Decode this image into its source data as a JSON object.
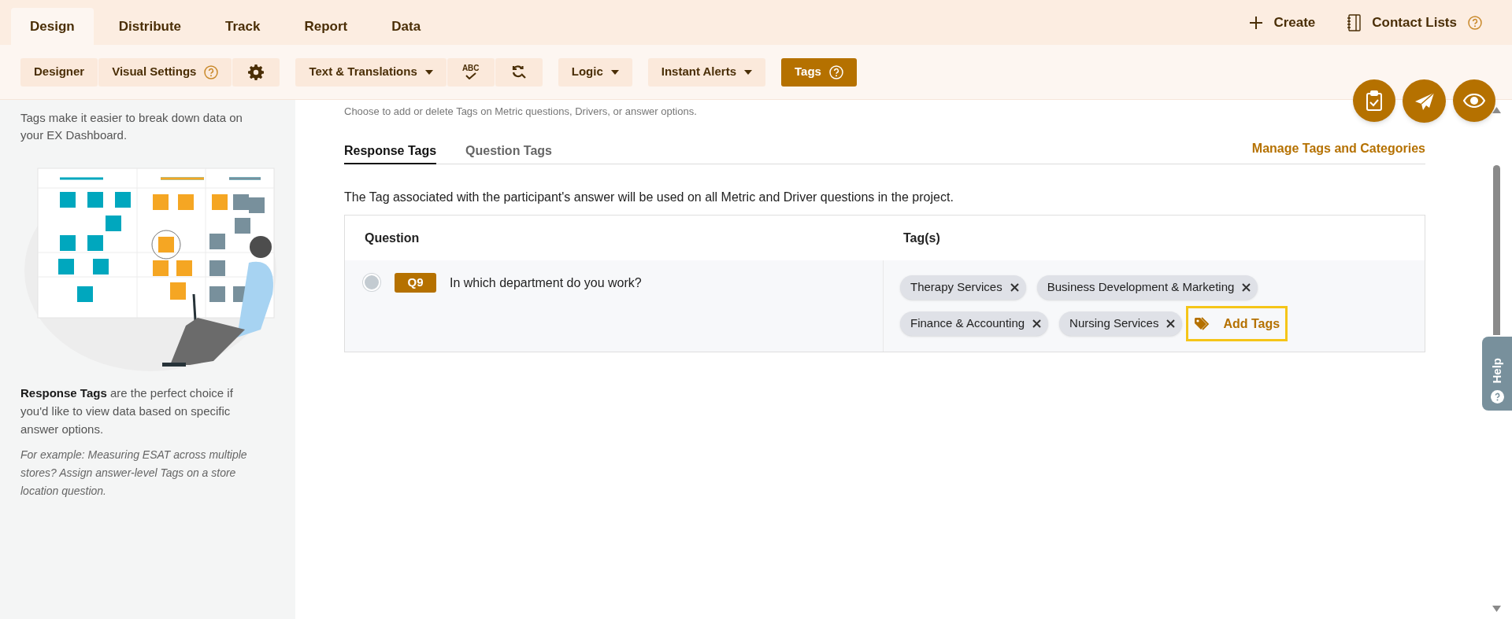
{
  "top_tabs": [
    {
      "label": "Design",
      "selected": true
    },
    {
      "label": "Distribute",
      "selected": false
    },
    {
      "label": "Track",
      "selected": false
    },
    {
      "label": "Report",
      "selected": false
    },
    {
      "label": "Data",
      "selected": false
    }
  ],
  "top_actions": [
    {
      "kind": "create",
      "label": "Create",
      "help": false
    },
    {
      "kind": "contacts",
      "label": "Contact Lists",
      "help": true
    }
  ],
  "toolbar": [
    [
      {
        "kind": "text",
        "label": "Designer",
        "help": false,
        "dropdown": false,
        "selected": false
      },
      {
        "kind": "text",
        "label": "Visual Settings",
        "help": true,
        "dropdown": false,
        "selected": false
      },
      {
        "kind": "gear"
      }
    ],
    [
      {
        "kind": "text",
        "label": "Text & Translations",
        "help": false,
        "dropdown": true,
        "selected": false
      },
      {
        "kind": "spellcheck",
        "label": "ABC"
      },
      {
        "kind": "find-replace"
      }
    ],
    [
      {
        "kind": "text",
        "label": "Logic",
        "help": false,
        "dropdown": true,
        "selected": false
      }
    ],
    [
      {
        "kind": "text",
        "label": "Instant Alerts",
        "help": false,
        "dropdown": true,
        "selected": false
      }
    ],
    [
      {
        "kind": "text",
        "label": "Tags",
        "help": true,
        "dropdown": false,
        "selected": true
      }
    ]
  ],
  "sidebar": {
    "intro": "Tags make it easier to break down data on your EX Dashboard.",
    "body": "**Response Tags** are the perfect choice if you'd like to view data based on specific answer options.",
    "example": "For example: Measuring ESAT across multiple stores? Assign answer-level Tags on a store location question."
  },
  "main": {
    "subtitle": "Choose to add or delete Tags on Metric questions, Drivers, or answer options.",
    "tabs": [
      {
        "label": "Response Tags",
        "selected": true
      },
      {
        "label": "Question Tags",
        "selected": false
      }
    ],
    "manage_link": "Manage Tags and Categories",
    "description": "The Tag associated with the participant's answer will be used on all Metric and Driver questions in the project.",
    "table": {
      "columns": [
        "Question",
        "Tag(s)"
      ],
      "rows": [
        {
          "selected": false,
          "badge": "Q9",
          "question": "In which department do you work?",
          "tags": [
            "Therapy Services",
            "Business Development & Marketing",
            "Finance & Accounting",
            "Nursing Services"
          ],
          "add_button": "Add Tags"
        }
      ]
    }
  },
  "help_tab": "Help"
}
